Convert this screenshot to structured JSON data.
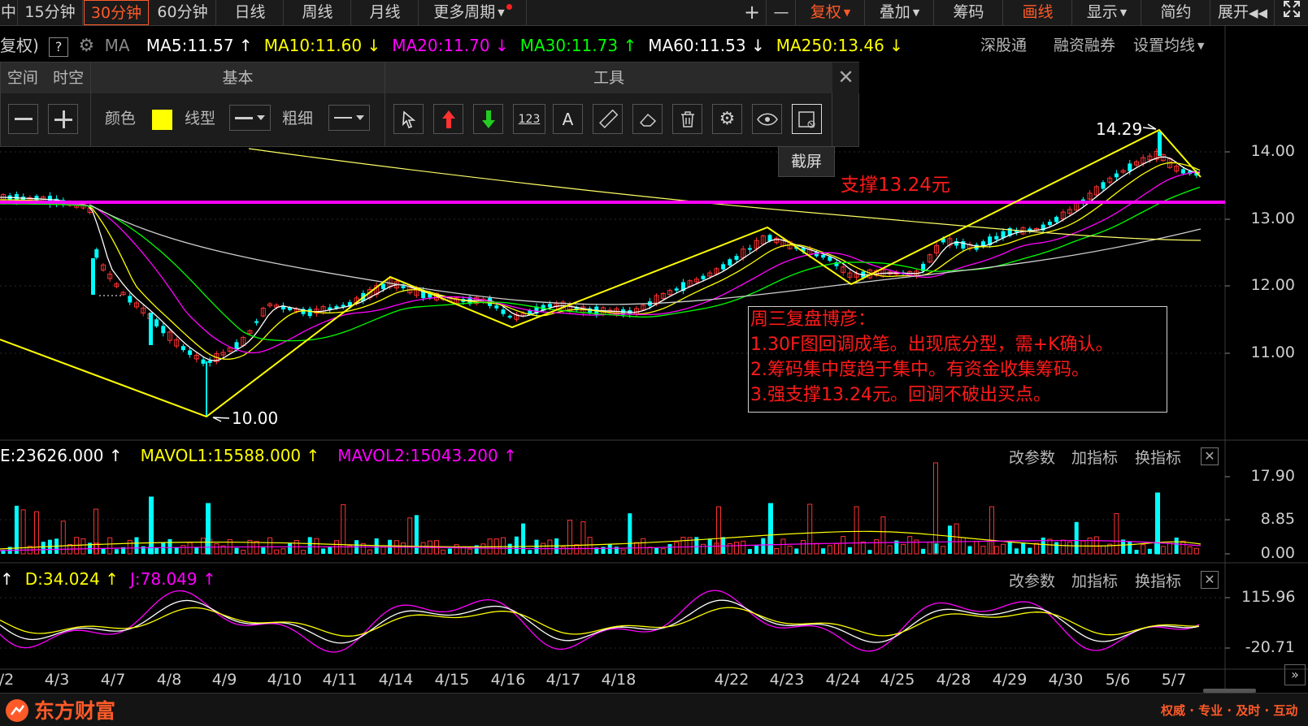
{
  "toolbar": {
    "periods": [
      {
        "label": "中"
      },
      {
        "label": "15分钟"
      },
      {
        "label": "30分钟"
      },
      {
        "label": "60分钟"
      },
      {
        "label": "日线"
      },
      {
        "label": "周线"
      },
      {
        "label": "月线"
      },
      {
        "label": "更多周期"
      }
    ],
    "plus": "+",
    "minus": "—",
    "fuquan": "复权",
    "diejia": "叠加",
    "chouma": "筹码",
    "huaxian": "画线",
    "xianshi": "显示",
    "jianyue": "简约",
    "zhankai": "展开",
    "accent": "#ff5a28"
  },
  "ma_bar": {
    "prefix": "复权)",
    "help": "?",
    "ma_label": "MA",
    "items": [
      {
        "text": "MA5:11.57",
        "color": "#ffffff",
        "arrow": "↑"
      },
      {
        "text": "MA10:11.60",
        "color": "#ffff00",
        "arrow": "↓"
      },
      {
        "text": "MA20:11.70",
        "color": "#ff00ff",
        "arrow": "↓"
      },
      {
        "text": "MA30:11.73",
        "color": "#00ff00",
        "arrow": "↑"
      },
      {
        "text": "MA60:11.53",
        "color": "#ffffff",
        "arrow": "↓"
      },
      {
        "text": "MA250:13.46",
        "color": "#ffff00",
        "arrow": "↓"
      }
    ],
    "links": [
      "深股通",
      "融资融券",
      "设置均线"
    ]
  },
  "panel": {
    "tabs": [
      "空间",
      "时空"
    ],
    "basic": "基本",
    "tools": "工具",
    "color_label": "颜色",
    "line_type_label": "线型",
    "thickness_label": "粗细",
    "color_value": "#ffff00",
    "tool_icons": [
      "cursor-icon",
      "up-arrow-icon",
      "down-arrow-icon",
      "number-123-icon",
      "text-a-icon",
      "ruler-icon",
      "eraser-icon",
      "trash-icon",
      "gear-icon",
      "eye-icon",
      "screenshot-icon"
    ],
    "num_icon_text": "123",
    "text_icon_text": "A",
    "tooltip": "截屏"
  },
  "price_axis": [
    "14.00",
    "13.00",
    "12.00",
    "11.00"
  ],
  "chart_labels": {
    "high": "14.29",
    "low": "10.00",
    "support": "支撑13.24元"
  },
  "annotation": {
    "lines": [
      "周三复盘博彦：",
      "1.30F图回调成笔。出现底分型，需+K确认。",
      "2.筹码集中度趋于集中。有资金收集筹码。",
      "3.强支撑13.24元。回调不破出买点。"
    ]
  },
  "volume": {
    "header": [
      {
        "text": "E:23626.000",
        "color": "#ffffff",
        "arrow": "↑"
      },
      {
        "text": "MAVOL1:15588.000",
        "color": "#ffff00",
        "arrow": "↑"
      },
      {
        "text": "MAVOL2:15043.200",
        "color": "#ff00ff",
        "arrow": "↑"
      }
    ],
    "axis": [
      "17.90",
      "8.85",
      "0.00"
    ],
    "links": [
      "改参数",
      "加指标",
      "换指标"
    ]
  },
  "kdj": {
    "header": [
      {
        "text": "↑",
        "color": "#ffffff",
        "arrow": ""
      },
      {
        "text": "D:34.024",
        "color": "#ffff00",
        "arrow": "↑"
      },
      {
        "text": "J:78.049",
        "color": "#ff00ff",
        "arrow": "↑"
      }
    ],
    "axis": [
      "115.96",
      "-20.71"
    ],
    "links": [
      "改参数",
      "加指标",
      "换指标"
    ]
  },
  "dates": [
    "/2",
    "4/3",
    "4/7",
    "4/8",
    "4/9",
    "4/10",
    "4/11",
    "4/14",
    "4/15",
    "4/16",
    "4/17",
    "4/18",
    "4/22",
    "4/23",
    "4/24",
    "4/25",
    "4/28",
    "4/29",
    "4/30",
    "5/6",
    "5/7"
  ],
  "footer": {
    "brand": "东方财富",
    "slogan": "权威 · 专业 · 及时 · 互动"
  },
  "colors": {
    "rise": "#ff3232",
    "fall": "#00ffff",
    "support_line": "#ff00ff",
    "pen_line": "#ffff00"
  }
}
